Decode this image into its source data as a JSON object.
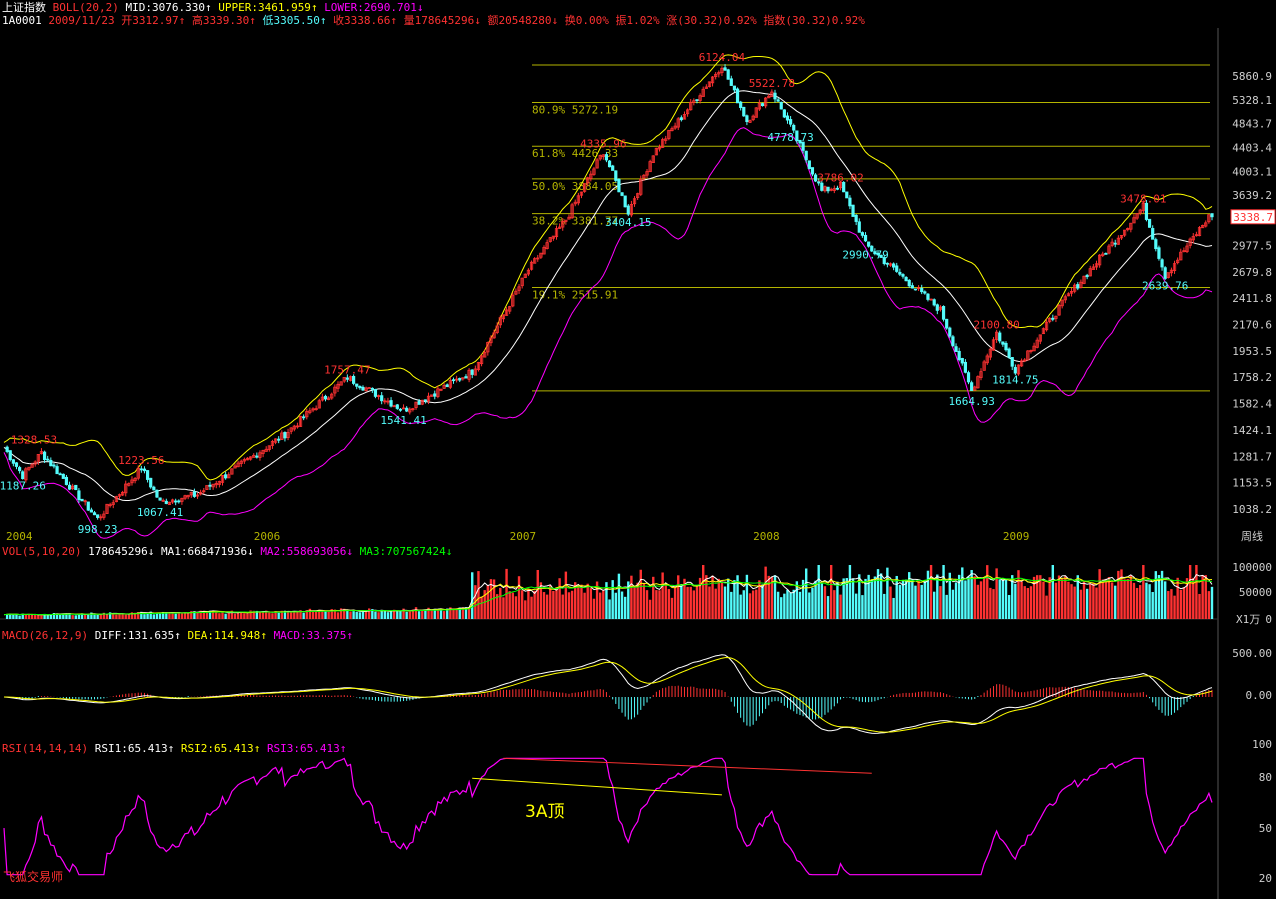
{
  "colors": {
    "bg": "#000000",
    "up": "#ff3232",
    "down": "#54fcfc",
    "upper": "#ffff00",
    "mid": "#ffffff",
    "lower": "#ff00ff",
    "fib": "#b4b400",
    "axis": "#d0d0d0",
    "ma1": "#ffffff",
    "ma2": "#ffff00",
    "ma3": "#00ff00",
    "rsi": "#ff00ff",
    "trend": "#ff3232",
    "label_hi": "#ff3232",
    "label_lo": "#54fcfc"
  },
  "header": {
    "index_name": "上证指数",
    "boll_name": "BOLL(20,2)",
    "mid": "MID:3076.330",
    "upper": "UPPER:3461.959",
    "lower": "LOWER:2690.701",
    "up_arrow": "↑",
    "down_arrow": "↓",
    "code": "1A0001",
    "date": "2009/11/23",
    "open": "开3312.97",
    "high": "高3339.30",
    "low": "低3305.50",
    "close": "收3338.66",
    "volume": "量178645296",
    "amount": "额20548280",
    "turnover": "换0.00%",
    "amplitude": "振1.02%",
    "change": "涨(30.32)0.92%",
    "change_idx": "指数(30.32)0.92%"
  },
  "vol_header": {
    "name": "VOL(5,10,20)",
    "value": "178645296",
    "ma1": "MA1:668471936",
    "ma2": "MA2:558693056",
    "ma3": "MA3:707567424"
  },
  "macd_header": {
    "name": "MACD(26,12,9)",
    "diff": "DIFF:131.635",
    "dea": "DEA:114.948",
    "macd": "MACD:33.375"
  },
  "rsi_header": {
    "name": "RSI(14,14,14)",
    "rsi1": "RSI1:65.413",
    "rsi2": "RSI2:65.413",
    "rsi3": "RSI3:65.413"
  },
  "price_axis": [
    "5860.9",
    "5328.1",
    "4843.7",
    "4403.4",
    "4003.1",
    "3639.2",
    "3338.7",
    "2977.5",
    "2679.8",
    "2411.8",
    "2170.6",
    "1953.5",
    "1758.2",
    "1582.4",
    "1424.1",
    "1281.7",
    "1153.5",
    "1038.2"
  ],
  "current_price": "3338.7",
  "year_labels": [
    "2004",
    "2006",
    "2007",
    "2008",
    "2009"
  ],
  "period_label": "周线",
  "vol_axis": [
    "100000",
    "50000",
    "X1万",
    "0"
  ],
  "macd_axis": [
    "500.00",
    "0.00"
  ],
  "rsi_axis": [
    "100",
    "80",
    "50",
    "20"
  ],
  "fib_labels": [
    "80.9% 5272.19",
    "61.8% 4426.33",
    "50.0% 3884.05",
    "38.2% 3381.77",
    "19.1% 2515.91"
  ],
  "price_labels": {
    "high_6124": "6124.04",
    "high_5522": "5522.78",
    "low_4778": "4778.73",
    "high_4335": "4335.96",
    "low_3404": "3404.15",
    "high_3786": "3786.02",
    "low_2990": "2990.79",
    "high_3478": "3478.01",
    "low_2639": "2639.76",
    "high_2100": "2100.80",
    "low_1814": "1814.75",
    "low_1664": "1664.93",
    "high_1757": "1757.47",
    "low_1541": "1541.41",
    "high_1223": "1223.56",
    "low_1067": "1067.41",
    "high_1328": "1328.53",
    "low_1187": "1187.26",
    "low_998": "998.23"
  },
  "annotation": "3A顶",
  "watermark": "飞狐交易师",
  "chart_data": {
    "type": "candlestick",
    "title": "上证指数",
    "period": "周线",
    "x_labels": [
      "2004",
      "2006",
      "2007",
      "2008",
      "2009"
    ],
    "price_ticks": [
      5860.9,
      5328.1,
      4843.7,
      4403.4,
      4003.1,
      3639.2,
      2977.5,
      2679.8,
      2411.8,
      2170.6,
      1953.5,
      1758.2,
      1582.4,
      1424.1,
      1281.7,
      1153.5,
      1038.2
    ],
    "fibonacci_levels": [
      {
        "pct": "80.9%",
        "value": 5272.19
      },
      {
        "pct": "61.8%",
        "value": 4426.33
      },
      {
        "pct": "50.0%",
        "value": 3884.05
      },
      {
        "pct": "38.2%",
        "value": 3381.77
      },
      {
        "pct": "19.1%",
        "value": 2515.91
      }
    ],
    "fib_top": 6124.04,
    "fib_bottom": 1664.93,
    "swing_points": [
      {
        "pos": 0,
        "value": 1328.53
      },
      {
        "pos": 6,
        "value": 1187.26
      },
      {
        "pos": 12,
        "value": 1300
      },
      {
        "pos": 30,
        "value": 998.23
      },
      {
        "pos": 44,
        "value": 1223.56
      },
      {
        "pos": 50,
        "value": 1067.41
      },
      {
        "pos": 62,
        "value": 1100
      },
      {
        "pos": 90,
        "value": 1400
      },
      {
        "pos": 110,
        "value": 1757.47
      },
      {
        "pos": 128,
        "value": 1541.41
      },
      {
        "pos": 150,
        "value": 1800
      },
      {
        "pos": 168,
        "value": 2700
      },
      {
        "pos": 180,
        "value": 3300
      },
      {
        "pos": 192,
        "value": 4335.96
      },
      {
        "pos": 200,
        "value": 3404.15
      },
      {
        "pos": 208,
        "value": 4300
      },
      {
        "pos": 230,
        "value": 6124.04
      },
      {
        "pos": 238,
        "value": 4900
      },
      {
        "pos": 246,
        "value": 5522.78
      },
      {
        "pos": 252,
        "value": 4778.73
      },
      {
        "pos": 262,
        "value": 3700
      },
      {
        "pos": 268,
        "value": 3786.02
      },
      {
        "pos": 276,
        "value": 2990.79
      },
      {
        "pos": 300,
        "value": 2300
      },
      {
        "pos": 310,
        "value": 1664.93
      },
      {
        "pos": 318,
        "value": 2100.8
      },
      {
        "pos": 324,
        "value": 1814.75
      },
      {
        "pos": 340,
        "value": 2400
      },
      {
        "pos": 365,
        "value": 3478.01
      },
      {
        "pos": 372,
        "value": 2639.76
      },
      {
        "pos": 386,
        "value": 3338.66
      }
    ],
    "last_bar": {
      "date": "2009/11/23",
      "open": 3312.97,
      "high": 3339.3,
      "low": 3305.5,
      "close": 3338.66,
      "volume": 178645296
    },
    "boll": {
      "mid": 3076.33,
      "upper": 3461.959,
      "lower": 2690.701
    },
    "volume": {
      "last": 178645296,
      "ma1": 668471936,
      "ma2": 558693056,
      "ma3": 707567424
    },
    "macd": {
      "diff": 131.635,
      "dea": 114.948,
      "macd": 33.375
    },
    "rsi": {
      "rsi1": 65.413,
      "rsi2": 65.413,
      "rsi3": 65.413
    }
  }
}
